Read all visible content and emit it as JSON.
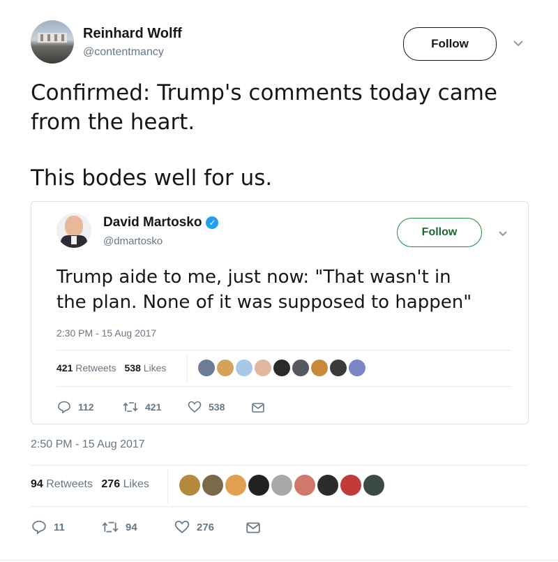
{
  "tweet": {
    "author_name": "Reinhard Wolff",
    "author_handle": "@contentmancy",
    "follow_label": "Follow",
    "text_line1": "Confirmed: Trump's comments today came",
    "text_line2": "from the heart.",
    "text_line3": "This bodes well for us.",
    "timestamp": "2:50 PM - 15 Aug 2017",
    "retweets_count": "94",
    "retweets_label": "Retweets",
    "likes_count": "276",
    "likes_label": "Likes",
    "reply_count": "11",
    "retweet_count": "94",
    "like_count": "276"
  },
  "quoted": {
    "author_name": "David Martosko",
    "author_handle": "@dmartosko",
    "verified_mark": "✓",
    "follow_label": "Follow",
    "text_line1": "Trump aide to me, just now: \"That wasn't in",
    "text_line2": "the plan. None of it was supposed to happen\"",
    "timestamp": "2:30 PM - 15 Aug 2017",
    "retweets_count": "421",
    "retweets_label": "Retweets",
    "likes_count": "538",
    "likes_label": "Likes",
    "reply_count": "112",
    "retweet_count": "421",
    "like_count": "538"
  },
  "colors": {
    "follow_border": "#14171a",
    "quoted_follow_border": "#1a8a3a",
    "muted": "#657786",
    "divider": "#e6ecf0"
  },
  "icons": [
    "reply-icon",
    "retweet-icon",
    "like-icon",
    "message-icon",
    "chevron-down-icon",
    "verified-icon"
  ]
}
